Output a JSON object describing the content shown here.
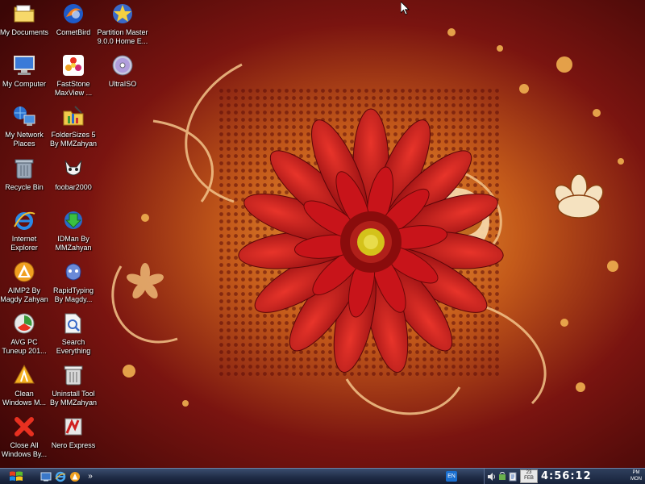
{
  "desktop": {
    "icons": [
      {
        "label": "My Documents",
        "icon": "folder-icon"
      },
      {
        "label": "CometBird",
        "icon": "cometbird-icon"
      },
      {
        "label": "Partition Master\n9.0.0 Home E...",
        "icon": "partition-master-icon"
      },
      {
        "label": "My Computer",
        "icon": "computer-icon"
      },
      {
        "label": "FastStone\nMaxView ...",
        "icon": "faststone-icon"
      },
      {
        "label": "UltraISO",
        "icon": "disc-icon"
      },
      {
        "label": "My Network\nPlaces",
        "icon": "network-icon"
      },
      {
        "label": "FolderSizes 5\nBy MMZahyan",
        "icon": "foldersizes-icon"
      },
      {
        "label": "Recycle Bin",
        "icon": "recycle-bin-icon"
      },
      {
        "label": "foobar2000",
        "icon": "foobar-icon"
      },
      {
        "label": "Internet\nExplorer",
        "icon": "internet-explorer-icon"
      },
      {
        "label": "IDMan By\nMMZahyan",
        "icon": "idm-icon"
      },
      {
        "label": "AIMP2  By\nMagdy Zahyan",
        "icon": "aimp-icon"
      },
      {
        "label": "RapidTyping\nBy Magdy...",
        "icon": "rapidtyping-icon"
      },
      {
        "label": "AVG PC\nTuneup 201...",
        "icon": "avg-icon"
      },
      {
        "label": "Search\nEverything",
        "icon": "search-everything-icon"
      },
      {
        "label": "Clean\nWindows M...",
        "icon": "clean-windows-icon"
      },
      {
        "label": "Uninstall Tool\nBy MMZahyan",
        "icon": "uninstall-tool-icon"
      },
      {
        "label": "Close All\nWindows By...",
        "icon": "close-all-icon"
      },
      {
        "label": "Nero Express",
        "icon": "nero-icon"
      }
    ]
  },
  "taskbar": {
    "quick_launch_more": "»",
    "language": "EN",
    "clock": {
      "date_line1": "23",
      "date_line2": "FEB",
      "hours": "4",
      "minutes": "56",
      "seconds": "12",
      "sep": ":",
      "ampm": "PM",
      "day": "MON"
    }
  },
  "colors": {
    "taskbar": "#1e2a44",
    "accent": "#b01010",
    "flower": "#c0141a"
  }
}
